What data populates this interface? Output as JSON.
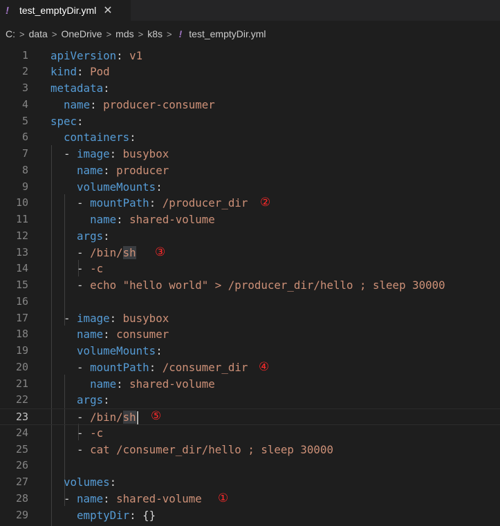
{
  "tab": {
    "title": "test_emptyDir.yml",
    "modified_glyph": "!",
    "close_glyph": "✕"
  },
  "breadcrumb": [
    "C:",
    "data",
    "OneDrive",
    "mds",
    "k8s",
    "test_emptyDir.yml"
  ],
  "breadcrumb_file_glyph": "!",
  "current_line": 23,
  "lines": [
    {
      "n": "1",
      "segs": [
        [
          "k",
          "apiVersion"
        ],
        [
          "p",
          ": "
        ],
        [
          "v",
          "v1"
        ]
      ]
    },
    {
      "n": "2",
      "segs": [
        [
          "k",
          "kind"
        ],
        [
          "p",
          ": "
        ],
        [
          "v",
          "Pod"
        ]
      ]
    },
    {
      "n": "3",
      "segs": [
        [
          "k",
          "metadata"
        ],
        [
          "p",
          ":"
        ]
      ]
    },
    {
      "n": "4",
      "segs": [
        [
          "p",
          "  "
        ],
        [
          "k",
          "name"
        ],
        [
          "p",
          ": "
        ],
        [
          "v",
          "producer-consumer"
        ]
      ]
    },
    {
      "n": "5",
      "segs": [
        [
          "k",
          "spec"
        ],
        [
          "p",
          ":"
        ]
      ]
    },
    {
      "n": "6",
      "segs": [
        [
          "p",
          "  "
        ],
        [
          "k",
          "containers"
        ],
        [
          "p",
          ":"
        ]
      ]
    },
    {
      "n": "7",
      "segs": [
        [
          "p",
          "  - "
        ],
        [
          "k",
          "image"
        ],
        [
          "p",
          ": "
        ],
        [
          "v",
          "busybox"
        ]
      ]
    },
    {
      "n": "8",
      "segs": [
        [
          "p",
          "    "
        ],
        [
          "k",
          "name"
        ],
        [
          "p",
          ": "
        ],
        [
          "v",
          "producer"
        ]
      ]
    },
    {
      "n": "9",
      "segs": [
        [
          "p",
          "    "
        ],
        [
          "k",
          "volumeMounts"
        ],
        [
          "p",
          ":"
        ]
      ]
    },
    {
      "n": "10",
      "segs": [
        [
          "p",
          "    - "
        ],
        [
          "k",
          "mountPath"
        ],
        [
          "p",
          ": "
        ],
        [
          "v",
          "/producer_dir"
        ]
      ]
    },
    {
      "n": "11",
      "segs": [
        [
          "p",
          "      "
        ],
        [
          "k",
          "name"
        ],
        [
          "p",
          ": "
        ],
        [
          "v",
          "shared-volume"
        ]
      ]
    },
    {
      "n": "12",
      "segs": [
        [
          "p",
          "    "
        ],
        [
          "k",
          "args"
        ],
        [
          "p",
          ":"
        ]
      ]
    },
    {
      "n": "13",
      "segs": [
        [
          "p",
          "    - "
        ],
        [
          "v",
          "/bin/"
        ],
        [
          "vh",
          "sh"
        ]
      ]
    },
    {
      "n": "14",
      "segs": [
        [
          "p",
          "    - "
        ],
        [
          "v",
          "-c"
        ]
      ]
    },
    {
      "n": "15",
      "segs": [
        [
          "p",
          "    - "
        ],
        [
          "v",
          "echo \"hello world\" > /producer_dir/hello ; sleep 30000"
        ]
      ]
    },
    {
      "n": "16",
      "segs": []
    },
    {
      "n": "17",
      "segs": [
        [
          "p",
          "  - "
        ],
        [
          "k",
          "image"
        ],
        [
          "p",
          ": "
        ],
        [
          "v",
          "busybox"
        ]
      ]
    },
    {
      "n": "18",
      "segs": [
        [
          "p",
          "    "
        ],
        [
          "k",
          "name"
        ],
        [
          "p",
          ": "
        ],
        [
          "v",
          "consumer"
        ]
      ]
    },
    {
      "n": "19",
      "segs": [
        [
          "p",
          "    "
        ],
        [
          "k",
          "volumeMounts"
        ],
        [
          "p",
          ":"
        ]
      ]
    },
    {
      "n": "20",
      "segs": [
        [
          "p",
          "    - "
        ],
        [
          "k",
          "mountPath"
        ],
        [
          "p",
          ": "
        ],
        [
          "v",
          "/consumer_dir"
        ]
      ]
    },
    {
      "n": "21",
      "segs": [
        [
          "p",
          "      "
        ],
        [
          "k",
          "name"
        ],
        [
          "p",
          ": "
        ],
        [
          "v",
          "shared-volume"
        ]
      ]
    },
    {
      "n": "22",
      "segs": [
        [
          "p",
          "    "
        ],
        [
          "k",
          "args"
        ],
        [
          "p",
          ":"
        ]
      ]
    },
    {
      "n": "23",
      "segs": [
        [
          "p",
          "    - "
        ],
        [
          "v",
          "/bin/"
        ],
        [
          "vh",
          "sh"
        ],
        [
          "cursor",
          ""
        ]
      ]
    },
    {
      "n": "24",
      "segs": [
        [
          "p",
          "    - "
        ],
        [
          "v",
          "-c"
        ]
      ]
    },
    {
      "n": "25",
      "segs": [
        [
          "p",
          "    - "
        ],
        [
          "v",
          "cat /consumer_dir/hello ; sleep 30000"
        ]
      ]
    },
    {
      "n": "26",
      "segs": []
    },
    {
      "n": "27",
      "segs": [
        [
          "p",
          "  "
        ],
        [
          "k",
          "volumes"
        ],
        [
          "p",
          ":"
        ]
      ]
    },
    {
      "n": "28",
      "segs": [
        [
          "p",
          "  - "
        ],
        [
          "k",
          "name"
        ],
        [
          "p",
          ": "
        ],
        [
          "v",
          "shared-volume"
        ]
      ]
    },
    {
      "n": "29",
      "segs": [
        [
          "p",
          "    "
        ],
        [
          "k",
          "emptyDir"
        ],
        [
          "p",
          ": "
        ],
        [
          "p",
          "{}"
        ]
      ]
    }
  ],
  "annotations": [
    {
      "line": "28",
      "label": "①"
    },
    {
      "line": "10",
      "label": "②"
    },
    {
      "line": "13",
      "label": "③"
    },
    {
      "line": "20",
      "label": "④"
    },
    {
      "line": "23",
      "label": "⑤"
    }
  ],
  "colors": {
    "key": "#569cd6",
    "string": "#ce9178",
    "annotation": "#ff2a2a",
    "yaml_icon": "#a074c4"
  }
}
